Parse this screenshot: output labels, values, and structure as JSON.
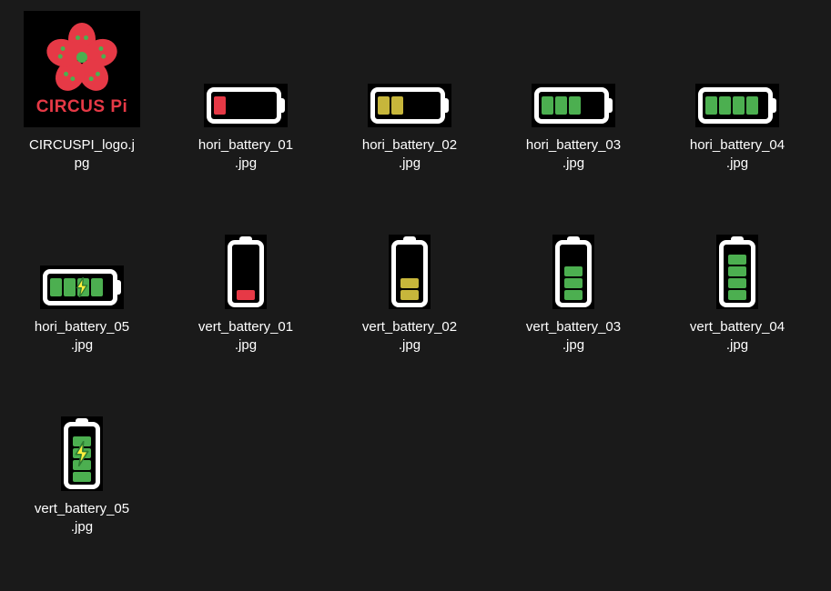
{
  "logo": {
    "text": "CIRCUS Pi"
  },
  "colors": {
    "red": "#e63946",
    "olive": "#c7b63b",
    "green": "#4caf50",
    "boltYellow": "#ffef3e",
    "boltGreenStroke": "#2e7d32"
  },
  "files": [
    {
      "id": "logo",
      "type": "logo",
      "filename": "CIRCUSPI_logo.jpg"
    },
    {
      "id": "h1",
      "type": "hbatt",
      "cells": 1,
      "color": "red",
      "bolt": false,
      "filename": "hori_battery_01.jpg"
    },
    {
      "id": "h2",
      "type": "hbatt",
      "cells": 2,
      "color": "olive",
      "bolt": false,
      "filename": "hori_battery_02.jpg"
    },
    {
      "id": "h3",
      "type": "hbatt",
      "cells": 3,
      "color": "green",
      "bolt": false,
      "filename": "hori_battery_03.jpg"
    },
    {
      "id": "h4",
      "type": "hbatt",
      "cells": 4,
      "color": "green",
      "bolt": false,
      "filename": "hori_battery_04.jpg"
    },
    {
      "id": "h5",
      "type": "hbatt",
      "cells": 4,
      "color": "green",
      "bolt": true,
      "filename": "hori_battery_05.jpg"
    },
    {
      "id": "v1",
      "type": "vbatt",
      "cells": 1,
      "color": "red",
      "bolt": false,
      "filename": "vert_battery_01.jpg"
    },
    {
      "id": "v2",
      "type": "vbatt",
      "cells": 2,
      "color": "olive",
      "bolt": false,
      "filename": "vert_battery_02.jpg"
    },
    {
      "id": "v3",
      "type": "vbatt",
      "cells": 3,
      "color": "green",
      "bolt": false,
      "filename": "vert_battery_03.jpg"
    },
    {
      "id": "v4",
      "type": "vbatt",
      "cells": 4,
      "color": "green",
      "bolt": false,
      "filename": "vert_battery_04.jpg"
    },
    {
      "id": "v5",
      "type": "vbatt",
      "cells": 4,
      "color": "green",
      "bolt": true,
      "filename": "vert_battery_05.jpg"
    }
  ]
}
